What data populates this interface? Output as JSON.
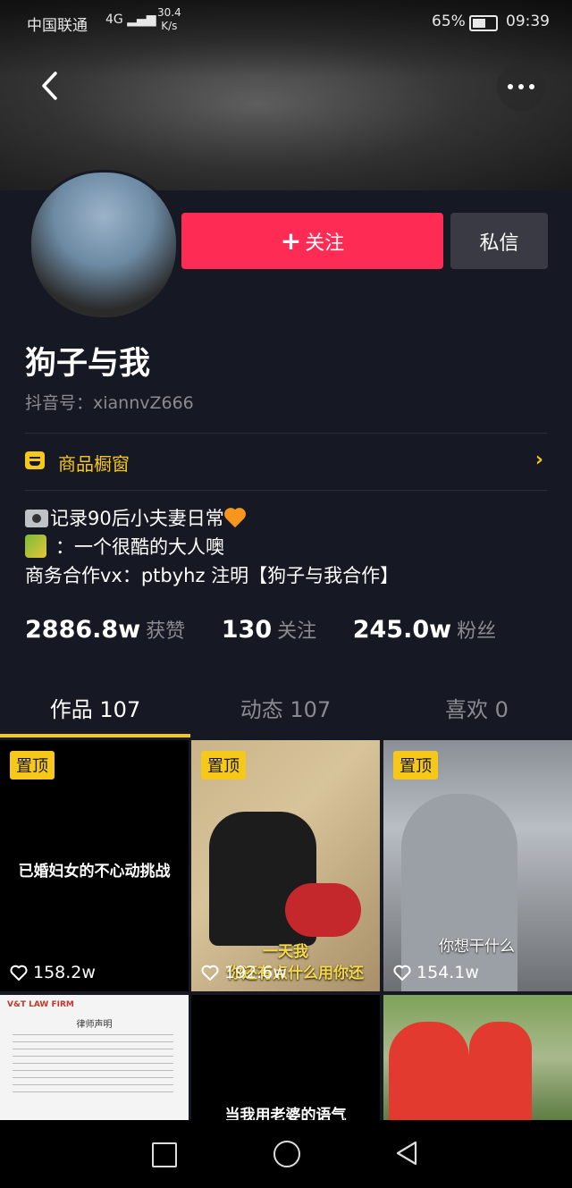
{
  "status_bar": {
    "carrier": "中国联通",
    "network": "4G",
    "speed_value": "30.4",
    "speed_unit": "K/s",
    "battery": "65%",
    "time": "09:39"
  },
  "header": {
    "back_icon": "chevron-left-icon",
    "more_icon": "more-dots-icon"
  },
  "profile": {
    "follow_label": "关注",
    "message_label": "私信",
    "nickname": "狗子与我",
    "douyin_id": "抖音号：xiannvZ666",
    "shop_label": "商品橱窗",
    "bio": [
      "记录90后小夫妻日常",
      "：一个很酷的大人噢",
      "商务合作vx：ptbyhz 注明【狗子与我合作】"
    ]
  },
  "stats": [
    {
      "value": "2886.8w",
      "label": "获赞"
    },
    {
      "value": "130",
      "label": "关注"
    },
    {
      "value": "245.0w",
      "label": "粉丝"
    }
  ],
  "tabs": [
    {
      "label": "作品 107",
      "active": true
    },
    {
      "label": "动态 107",
      "active": false
    },
    {
      "label": "喜欢 0",
      "active": false
    }
  ],
  "videos": [
    {
      "pinned_label": "置顶",
      "caption": "已婚妇女的不心动挑战",
      "likes": "158.2w"
    },
    {
      "pinned_label": "置顶",
      "caption_lines": [
        "一天我",
        "你还有点什么用你还"
      ],
      "likes": "192.6w"
    },
    {
      "pinned_label": "置顶",
      "caption": "你想干什么",
      "likes": "154.1w"
    },
    {
      "doc_firm": "V&T LAW FIRM",
      "doc_title": "律师声明"
    },
    {
      "caption": "当我用老婆的语气"
    },
    {}
  ],
  "colors": {
    "background": "#161823",
    "accent_red": "#fe2c55",
    "accent_yellow": "#f6c81a",
    "muted_text": "#8a8b91"
  }
}
